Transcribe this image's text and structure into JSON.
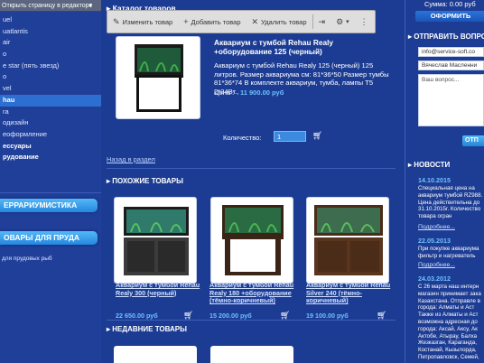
{
  "editor": {
    "label": "Открыть страницу в редакторе",
    "chevron": "▾"
  },
  "sidebar": {
    "items": [
      {
        "label": "uel"
      },
      {
        "label": "uatlantis"
      },
      {
        "label": "air"
      },
      {
        "label": "o"
      },
      {
        "label": "e star (пять звезд)"
      },
      {
        "label": "o"
      },
      {
        "label": "vel"
      },
      {
        "label": "hau"
      },
      {
        "label": "ra"
      },
      {
        "label": "одизайн"
      },
      {
        "label": "еоформление"
      },
      {
        "label": "ессуары"
      },
      {
        "label": "рудование"
      }
    ],
    "btn_terrarium": "ЕРРАРИУМИСТИКА",
    "btn_ponds": "ОВАРЫ ДЛЯ ПРУДА",
    "ponds_text": "для прудовых рыб"
  },
  "toolbar": {
    "edit_label": "Изменить товар",
    "add_label": "Добавить товар",
    "delete_label": "Удалить товар"
  },
  "breadcrumb": "Каталог товаров",
  "product": {
    "title": "Аквариум с тумбой Rehau Realy +оборудование 125 (черный)",
    "description": "Аквариум с тумбой Rehau Realy 125 (черный) 125 литров. Размер аквариума см: 81*36*50 Размер тумбы 81*36*74 В комплекте аквариум, тумба, лампы Т5 2*24Вт.,",
    "price_label": "Цена :",
    "price": "11 900.00 руб",
    "qty_label": "Количество:",
    "qty_value": "1"
  },
  "back_link": "Назад в раздел",
  "similar": {
    "title": "ПОХОЖИЕ ТОВАРЫ",
    "items": [
      {
        "name": "Аквариум с тумбой Rehau Realy 300 (черный)",
        "price": "22 650.00 руб"
      },
      {
        "name": "Аквариум с тумбой Rehau Realy 180 +оборудование (тёмно-коричневый)",
        "price": "15 200.00 руб"
      },
      {
        "name": "Аквариум с тумбой Rehau Silver 240 (тёмно-коричневый)",
        "price": "19 100.00 руб"
      }
    ]
  },
  "recent": {
    "title": "НЕДАВНИЕ ТОВАРЫ"
  },
  "right": {
    "sum_text": "Сумма: 0.00 руб",
    "order_button": "ОФОРМИТЬ",
    "question_title": "ОТПРАВИТЬ ВОПРОС",
    "email_value": "info@service-soft.co",
    "name_value": "Вячеслав Масленни",
    "question_placeholder": "Ваш вопрос...",
    "send_button": "ОТП",
    "news_title": "НОВОСТИ",
    "news": [
      {
        "date": "14.10.2015",
        "text": "Специальная цена на аквариум тумбой RZ988. Цена действительна до 31.10.2015г. Количество товара огран",
        "more": "Подробнее..."
      },
      {
        "date": "22.05.2013",
        "text": "При покупке аквариума фильтр и нагреватель",
        "more": "Подробнее..."
      },
      {
        "date": "24.03.2012",
        "text": "С 26 марта наш интерн магазин принимает зака Казахстана. Отправле в города: Алматы и Аст Также из Алматы и Аст возможна адресная до города: Аксай, Аксу, Ак Актобе, Атырау, Балха Жезказган, Караганда, Костанай, Кызылорда, Петропавловск, Семей,",
        "more": ""
      }
    ]
  }
}
